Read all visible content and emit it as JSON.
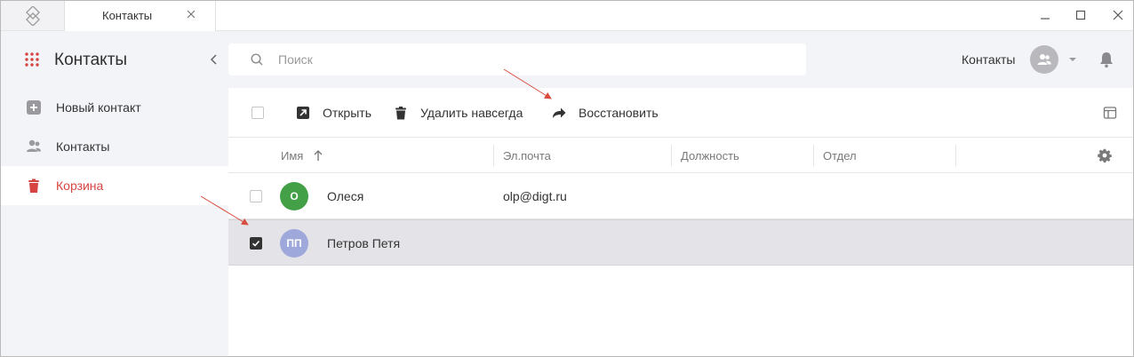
{
  "tab": {
    "title": "Контакты"
  },
  "sidebar": {
    "title": "Контакты",
    "items": [
      {
        "label": "Новый контакт",
        "icon": "add-square-icon"
      },
      {
        "label": "Контакты",
        "icon": "contacts-icon"
      },
      {
        "label": "Корзина",
        "icon": "trash-icon",
        "active": true
      }
    ]
  },
  "search": {
    "placeholder": "Поиск",
    "value": ""
  },
  "user": {
    "label": "Контакты"
  },
  "toolbar": {
    "open_label": "Открыть",
    "delete_label": "Удалить навсегда",
    "restore_label": "Восстановить"
  },
  "table": {
    "columns": [
      "Имя",
      "Эл.почта",
      "Должность",
      "Отдел"
    ],
    "sort": {
      "column": "Имя",
      "direction": "asc"
    },
    "rows": [
      {
        "initials": "О",
        "name": "Олеся",
        "email": "olp@digt.ru",
        "avatar_color": "#43a047",
        "checked": false
      },
      {
        "initials": "ПП",
        "name": "Петров Петя",
        "email": "",
        "avatar_color": "#9fa8da",
        "checked": true
      }
    ]
  },
  "colors": {
    "accent": "#d64541",
    "sidebar_bg": "#f3f4f8",
    "selected_row": "#e4e4e8"
  }
}
